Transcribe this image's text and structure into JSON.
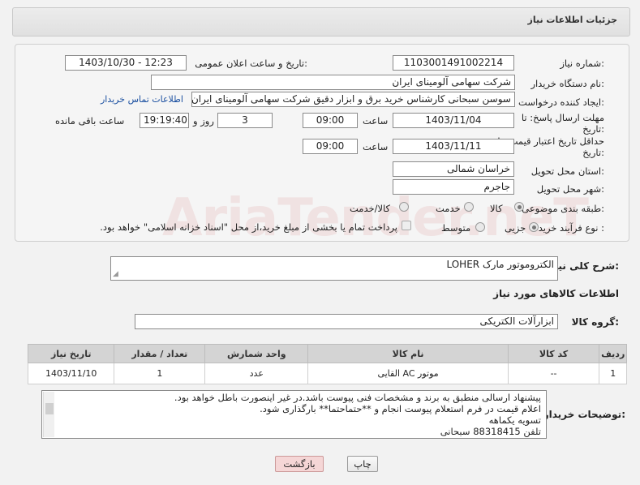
{
  "header": {
    "title": "جزئیات اطلاعات نیاز"
  },
  "form": {
    "need_number_label": "شماره نیاز:",
    "need_number": "1103001491002214",
    "announce_label": "تاریخ و ساعت اعلان عمومی:",
    "announce_value": "1403/10/30 - 12:23",
    "buyer_label": "نام دستگاه خریدار:",
    "buyer_value": "شرکت سهامی آلومینای ایران",
    "creator_label": "ایجاد کننده درخواست:",
    "creator_value": "سوسن سبحانی کارشناس خرید برق و ابزار دقیق شرکت سهامی آلومینای ایران",
    "contact_link": "اطلاعات تماس خریدار",
    "deadline_label_1": "مهلت ارسال پاسخ: تا",
    "deadline_label_2": "تاریخ:",
    "deadline_date": "1403/11/04",
    "time_word": "ساعت",
    "deadline_time": "09:00",
    "days_value": "3",
    "days_word": "روز و",
    "remaining_time": "19:19:40",
    "remaining_word": "ساعت باقی مانده",
    "validity_label_1": "حداقل تاریخ اعتبار قیمت: تا",
    "validity_label_2": "تاریخ:",
    "validity_date": "1403/11/11",
    "validity_time": "09:00",
    "province_label": "استان محل تحویل:",
    "province_value": "خراسان شمالی",
    "city_label": "شهر محل تحویل:",
    "city_value": "جاجرم",
    "category_label": "طبقه بندی موضوعی:",
    "category_options": [
      "کالا",
      "خدمت",
      "کالا/خدمت"
    ],
    "process_label": "نوع فرآیند خرید :",
    "process_options": [
      "جزیی",
      "متوسط"
    ],
    "payment_note": "پرداخت تمام یا بخشی از مبلغ خرید،از محل \"اسناد خزانه اسلامی\" خواهد بود."
  },
  "summary": {
    "label": "شرح کلی نیاز:",
    "value": "الکتروموتور مارک LOHER"
  },
  "goods_info_title": "اطلاعات کالاهای مورد نیاز",
  "goods_group": {
    "label": "گروه کالا:",
    "value": "ابزارآلات الکتریکی"
  },
  "table": {
    "headers": [
      "ردیف",
      "کد کالا",
      "نام کالا",
      "واحد شمارش",
      "تعداد / مقدار",
      "تاریخ نیاز"
    ],
    "rows": [
      [
        "1",
        "--",
        "موتور AC القایی",
        "عدد",
        "1",
        "1403/11/10"
      ]
    ]
  },
  "notes": {
    "label": "توضیحات خریدار:",
    "lines": [
      "پیشنهاد ارسالی منطبق به برند و مشخصات فنی پیوست باشد.در غیر اینصورت باطل خواهد بود.",
      "اعلام قیمت در فرم استعلام پیوست انجام و **حتماحتما** بارگذاری شود.",
      "تسویه یکماهه",
      "تلفن 88318415 سبحانی"
    ]
  },
  "buttons": {
    "print": "چاپ",
    "back": "بازگشت"
  },
  "watermark": "AriaTender.neT"
}
